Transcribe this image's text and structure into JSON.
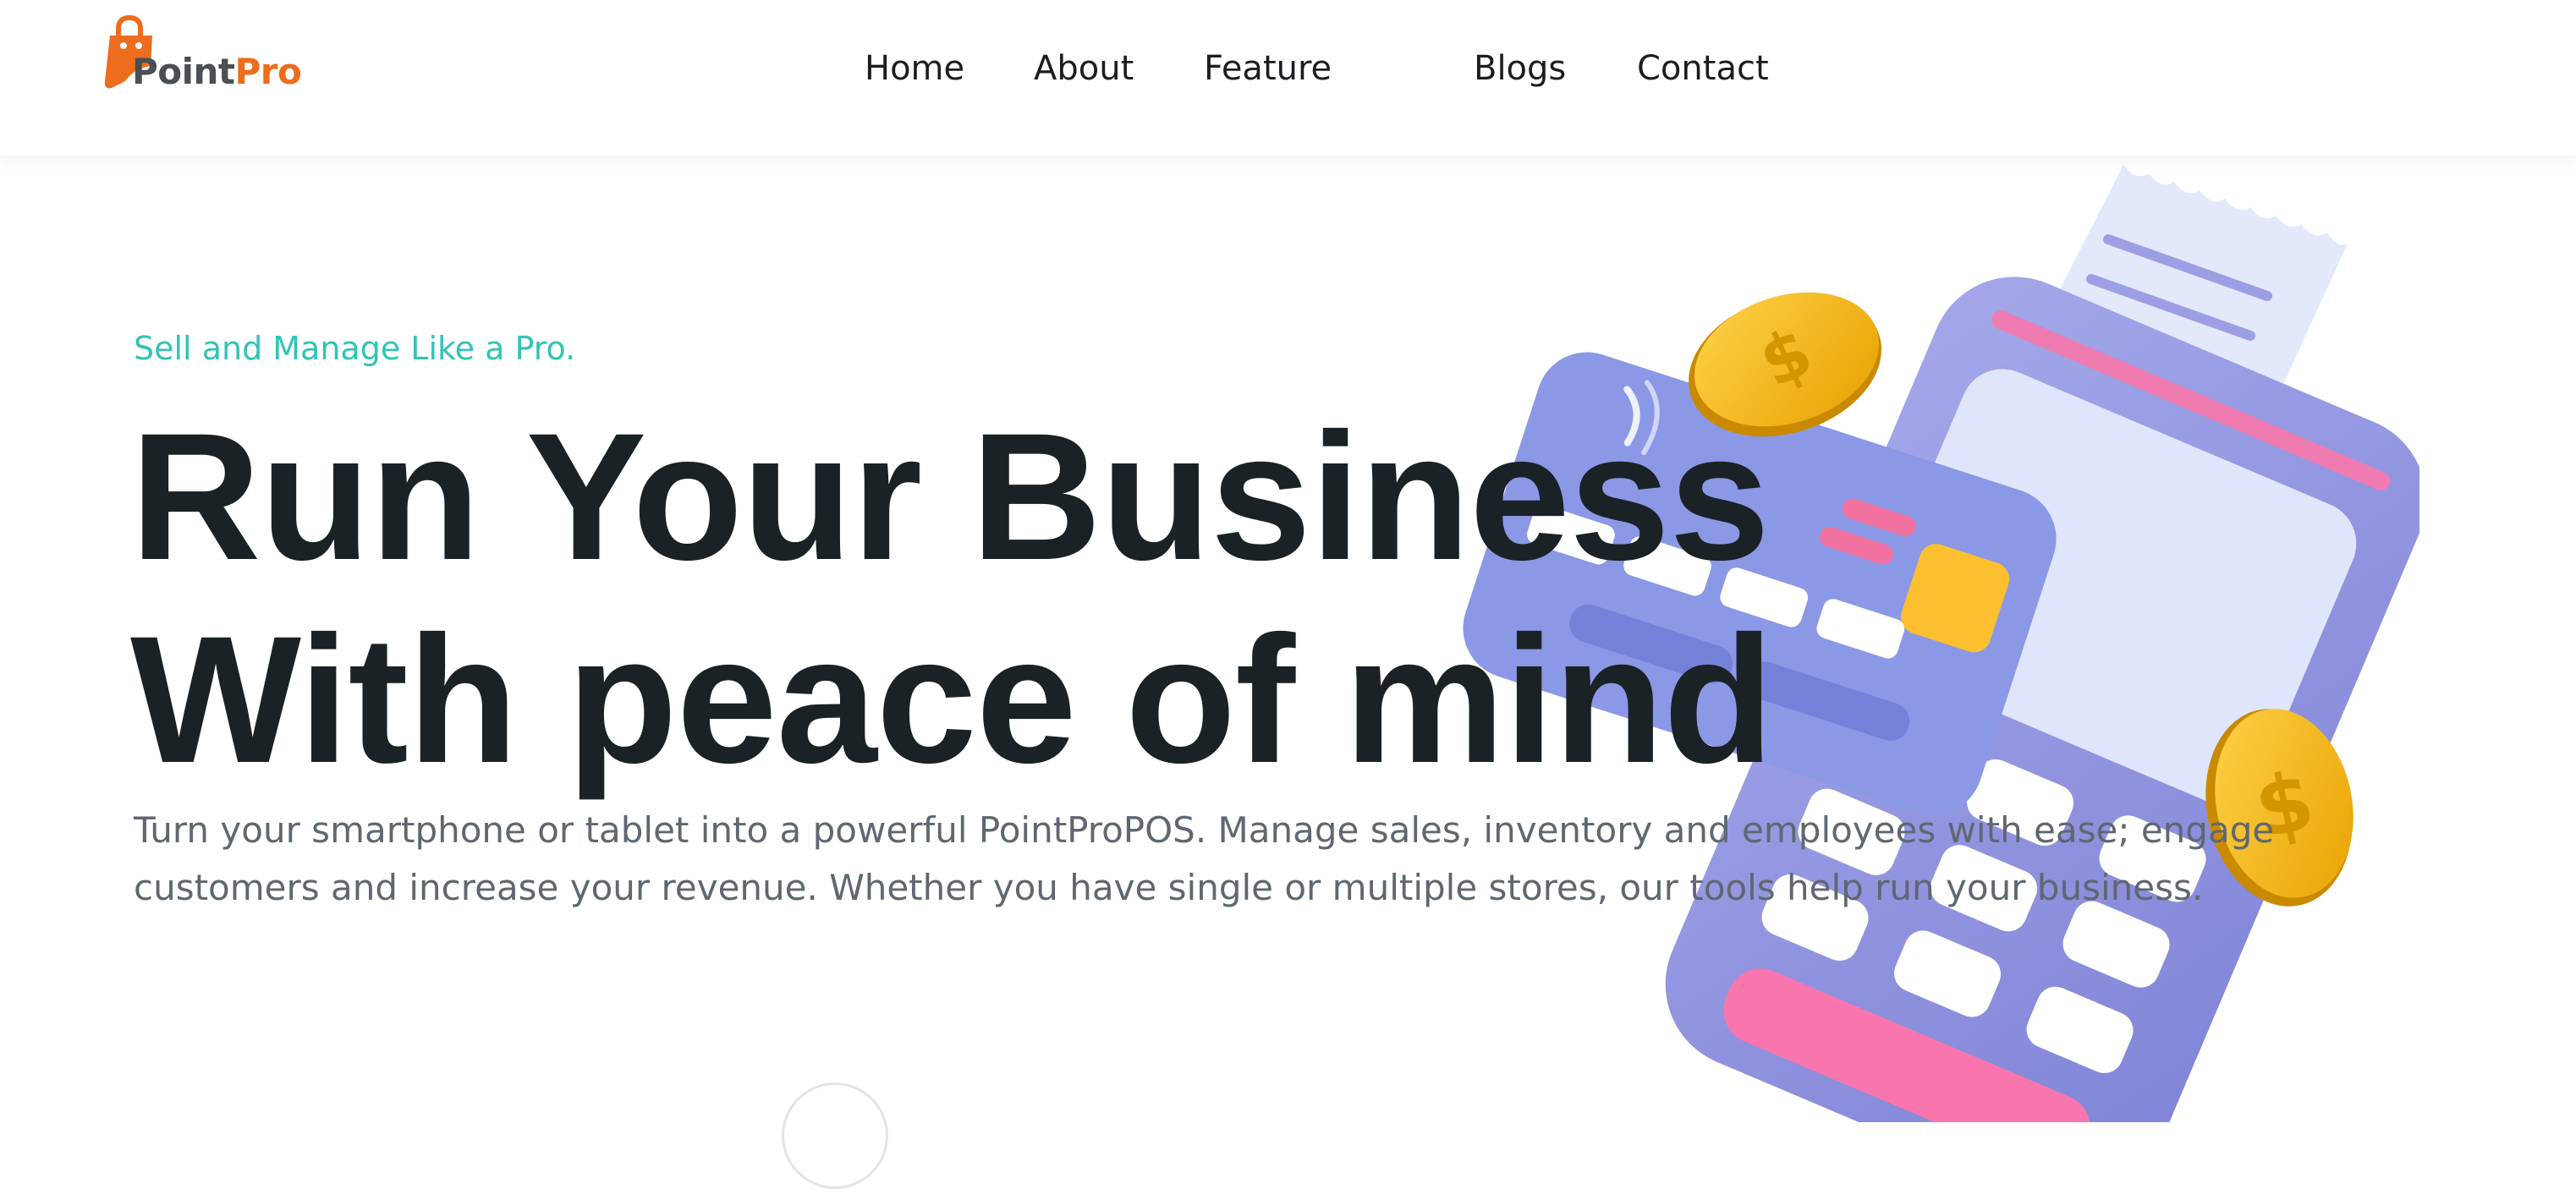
{
  "brand": {
    "name_part1": "Point",
    "name_part2": "Pro",
    "colors": {
      "dark": "#4a4e55",
      "accent": "#ee6c1d"
    }
  },
  "nav": {
    "items": [
      "Home",
      "About",
      "Feature",
      "Blogs",
      "Contact"
    ]
  },
  "hero": {
    "tagline": "Sell and Manage Like a Pro.",
    "headline_line1": "Run Your Business",
    "headline_line2": "With peace of mind",
    "description_line1": "Turn your smartphone or tablet into a powerful PointProPOS. Manage sales, inventory and employees with ease; engage",
    "description_line2": "customers and increase your revenue. Whether you have single or multiple stores, our tools help run your business.",
    "colors": {
      "tagline": "#31c4b4",
      "headline": "#1b2226",
      "body": "#5f6770"
    }
  },
  "illustration": {
    "icons": [
      "pos-terminal-icon",
      "credit-card-icon",
      "receipt-icon",
      "dollar-coin-icon"
    ]
  }
}
